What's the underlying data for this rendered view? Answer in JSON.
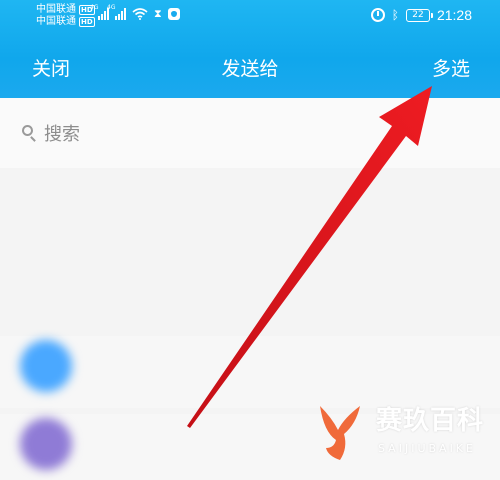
{
  "status_bar": {
    "carrier_1": "中国联通",
    "carrier_2": "中国联通",
    "hd_badge": "HD",
    "net_type": "4G",
    "battery": "22",
    "time": "21:28",
    "icons": [
      "signal-icon",
      "wifi-icon",
      "hourglass-icon",
      "shield-badge-icon",
      "alarm-icon",
      "bluetooth-icon",
      "battery-icon"
    ]
  },
  "header": {
    "close_label": "关闭",
    "title": "发送给",
    "multi_select_label": "多选",
    "background_color": "#10a7ec"
  },
  "search": {
    "placeholder": "搜索",
    "icon": "search-icon"
  },
  "list": {
    "heading": "",
    "section_label": "",
    "rows": [
      {
        "name": "",
        "avatar_color": "#4aa8ff"
      },
      {
        "name": "",
        "avatar_color": "#8f7bd6"
      }
    ]
  },
  "annotation": {
    "arrow_color": "#e8141b",
    "points_to": "多选"
  },
  "watermark": {
    "text": "赛玖百科",
    "subtext": "SAIJIUBAIKE",
    "logo": "whale-tail-logo"
  }
}
